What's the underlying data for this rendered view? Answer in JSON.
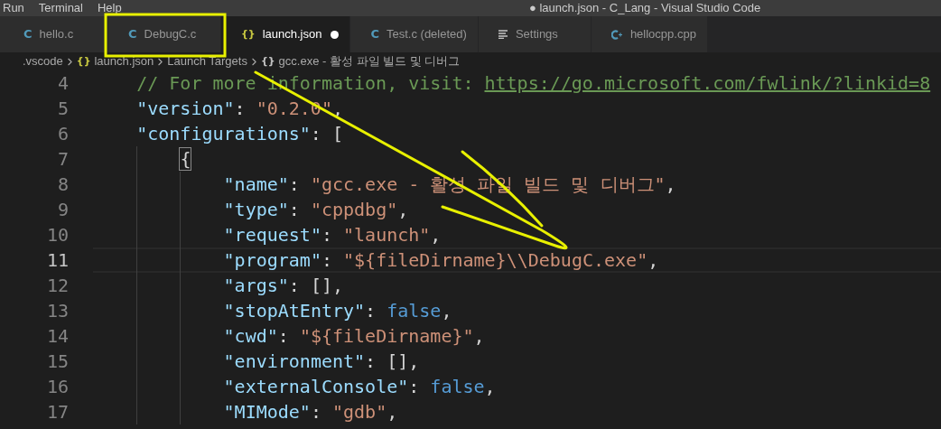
{
  "menu": [
    "Run",
    "Terminal",
    "Help"
  ],
  "window": {
    "title": "● launch.json - C_Lang - Visual Studio Code"
  },
  "tabs": [
    {
      "label": "hello.c",
      "kind": "c",
      "glyph": "C",
      "selected": false,
      "modified": false
    },
    {
      "label": "DebugC.c",
      "kind": "c",
      "glyph": "C",
      "selected": false,
      "modified": false
    },
    {
      "label": "launch.json",
      "kind": "json",
      "glyph": "{}",
      "selected": true,
      "modified": true
    },
    {
      "label": "Test.c (deleted)",
      "kind": "c",
      "glyph": "C",
      "selected": false,
      "modified": false
    },
    {
      "label": "Settings",
      "kind": "settings",
      "selected": false,
      "modified": false
    },
    {
      "label": "hellocpp.cpp",
      "kind": "cpp",
      "selected": false,
      "modified": false
    }
  ],
  "breadcrumb": [
    {
      "label": ".vscode"
    },
    {
      "label": "launch.json",
      "glyph": "{}"
    },
    {
      "label": "Launch Targets"
    },
    {
      "label": "gcc.exe - 활성 파일 빌드 및 디버그",
      "glyph": "{}"
    }
  ],
  "code": [
    {
      "number": "4",
      "current": false,
      "tokens": [
        {
          "kind": "comment",
          "text": "// For more information, visit: "
        },
        {
          "kind": "link",
          "text": "https://go.microsoft.com/fwlink/?linkid=8"
        }
      ]
    },
    {
      "number": "5",
      "current": false,
      "tokens": [
        {
          "kind": "key",
          "text": "\"version\""
        },
        {
          "kind": "punct",
          "text": ": "
        },
        {
          "kind": "string",
          "text": "\"0.2.0\""
        },
        {
          "kind": "punct",
          "text": ","
        }
      ]
    },
    {
      "number": "6",
      "current": false,
      "tokens": [
        {
          "kind": "key",
          "text": "\"configurations\""
        },
        {
          "kind": "punct",
          "text": ": ["
        }
      ],
      "children": [
        {
          "number": "7",
          "current": false,
          "tokens": [
            {
              "kind": "punct",
              "text": "{",
              "matched": true
            }
          ],
          "children": [
            {
              "number": "8",
              "current": false,
              "tokens": [
                {
                  "kind": "key",
                  "text": "\"name\""
                },
                {
                  "kind": "punct",
                  "text": ": "
                },
                {
                  "kind": "string",
                  "text": "\"gcc.exe - 활성 파일 빌드 및 디버그\""
                },
                {
                  "kind": "punct",
                  "text": ","
                }
              ]
            },
            {
              "number": "9",
              "current": false,
              "tokens": [
                {
                  "kind": "key",
                  "text": "\"type\""
                },
                {
                  "kind": "punct",
                  "text": ": "
                },
                {
                  "kind": "string",
                  "text": "\"cppdbg\""
                },
                {
                  "kind": "punct",
                  "text": ","
                }
              ]
            },
            {
              "number": "10",
              "current": false,
              "tokens": [
                {
                  "kind": "key",
                  "text": "\"request\""
                },
                {
                  "kind": "punct",
                  "text": ": "
                },
                {
                  "kind": "string",
                  "text": "\"launch\""
                },
                {
                  "kind": "punct",
                  "text": ","
                }
              ]
            },
            {
              "number": "11",
              "current": true,
              "tokens": [
                {
                  "kind": "key",
                  "text": "\"program\""
                },
                {
                  "kind": "punct",
                  "text": ": "
                },
                {
                  "kind": "string",
                  "text": "\"${fileDirname}\\\\DebugC.exe\""
                },
                {
                  "kind": "punct",
                  "text": ","
                }
              ]
            },
            {
              "number": "12",
              "current": false,
              "tokens": [
                {
                  "kind": "key",
                  "text": "\"args\""
                },
                {
                  "kind": "punct",
                  "text": ": [],"
                }
              ]
            },
            {
              "number": "13",
              "current": false,
              "tokens": [
                {
                  "kind": "key",
                  "text": "\"stopAtEntry\""
                },
                {
                  "kind": "punct",
                  "text": ": "
                },
                {
                  "kind": "keyword",
                  "text": "false"
                },
                {
                  "kind": "punct",
                  "text": ","
                }
              ]
            },
            {
              "number": "14",
              "current": false,
              "tokens": [
                {
                  "kind": "key",
                  "text": "\"cwd\""
                },
                {
                  "kind": "punct",
                  "text": ": "
                },
                {
                  "kind": "string",
                  "text": "\"${fileDirname}\""
                },
                {
                  "kind": "punct",
                  "text": ","
                }
              ]
            },
            {
              "number": "15",
              "current": false,
              "tokens": [
                {
                  "kind": "key",
                  "text": "\"environment\""
                },
                {
                  "kind": "punct",
                  "text": ": [],"
                }
              ]
            },
            {
              "number": "16",
              "current": false,
              "tokens": [
                {
                  "kind": "key",
                  "text": "\"externalConsole\""
                },
                {
                  "kind": "punct",
                  "text": ": "
                },
                {
                  "kind": "keyword",
                  "text": "false"
                },
                {
                  "kind": "punct",
                  "text": ","
                }
              ]
            },
            {
              "number": "17",
              "current": false,
              "tokens": [
                {
                  "kind": "key",
                  "text": "\"MIMode\""
                },
                {
                  "kind": "punct",
                  "text": ": "
                },
                {
                  "kind": "string",
                  "text": "\"gdb\""
                },
                {
                  "kind": "punct",
                  "text": ","
                }
              ]
            }
          ]
        }
      ]
    }
  ]
}
